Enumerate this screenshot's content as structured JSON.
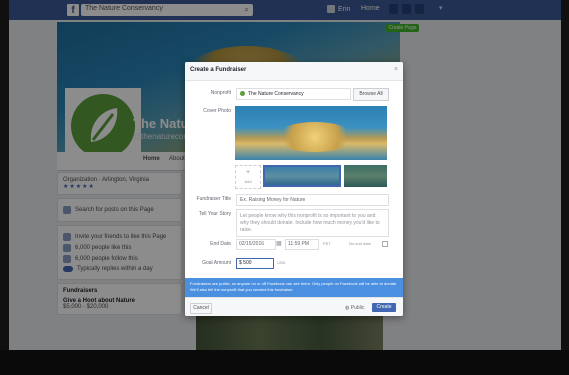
{
  "topbar": {
    "logo": "f",
    "search_value": "The Nature Conservancy",
    "user_name": "Erin",
    "home_label": "Home"
  },
  "page": {
    "name": "The Nature",
    "subtitle": "@thenatureconservancy",
    "create_page_label": "Create Page",
    "tabs": [
      "Home",
      "About"
    ],
    "info_text": "Organization · Arlington, Virginia",
    "stars": "★★★★★",
    "search_posts": "Search for posts on this Page",
    "invite_text": "Invite your friends to like this Page",
    "people_like": "6,000 people like this",
    "people_follow": "6,000 people follow this",
    "response_text": "Typically replies within a day",
    "fundraisers_title": "Fundraisers",
    "fundraiser_item": "Give a Hoot about Nature",
    "fundraiser_amount": "$5,000 · $20,000"
  },
  "modal": {
    "title": "Create a Fundraiser",
    "close": "×",
    "labels": {
      "nonprofit": "Nonprofit",
      "cover_photo": "Cover Photo",
      "fundraiser_title": "Fundraiser Title",
      "tell_story": "Tell Your Story",
      "end_date": "End Date",
      "goal_amount": "Goal Amount"
    },
    "nonprofit_value": "The Nature Conservancy",
    "browse_label": "Browse All",
    "add_photo_plus": "+",
    "add_photo_label": "Add",
    "title_placeholder": "Ex. Raising Money for Nature",
    "story_placeholder": "Let people know why this nonprofit is so important to you and why they should donate. Include how much money you'd like to raise.",
    "end_date_value": "02/15/2016",
    "end_time_value": "11:59 PM",
    "timezone": "PST",
    "no_end_label": "No end date",
    "goal_value": "$ 500",
    "currency": "USD",
    "notice": "Fundraisers are public, so anyone on or off Facebook can see them. Only people on Facebook will be able to donate. We'll also tell the nonprofit that you created this fundraiser.",
    "cancel_label": "Cancel",
    "privacy_label": "Public",
    "create_label": "Create"
  }
}
